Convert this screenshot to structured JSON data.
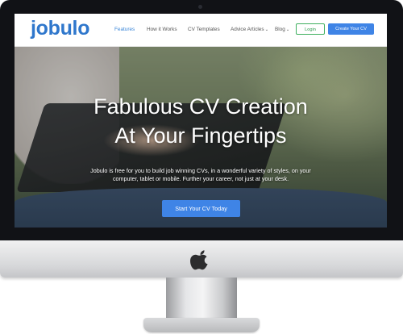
{
  "brand": {
    "name": "jobulo",
    "color": "#2f77cc"
  },
  "nav": {
    "items": [
      {
        "label": "Features",
        "active": true
      },
      {
        "label": "How it Works",
        "active": false
      },
      {
        "label": "CV Templates",
        "active": false
      },
      {
        "label": "Advice Articles",
        "dropdown": true
      },
      {
        "label": "Blog",
        "dropdown": true
      }
    ],
    "login_label": "Login",
    "create_label": "Create Your CV",
    "accent_color": "#3f84e6",
    "login_color": "#3fb05f"
  },
  "hero": {
    "title_line1": "Fabulous CV Creation",
    "title_line2": "At Your Fingertips",
    "description": "Jobulo is free for you to build job winning CVs, in a wonderful variety of styles, on your computer, tablet or mobile. Further your career, not just at your desk.",
    "cta_label": "Start Your CV Today"
  },
  "icons": {
    "device_logo": "apple-logo",
    "dropdown": "chevron-down-icon"
  }
}
